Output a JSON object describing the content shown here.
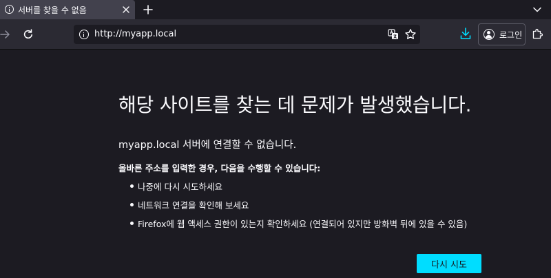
{
  "tab": {
    "title": "서버를 찾을 수 없음"
  },
  "toolbar": {
    "url": "http://myapp.local",
    "login_label": "로그인"
  },
  "error": {
    "title": "해당 사이트를 찾는 데 문제가 발생했습니다.",
    "lead": "myapp.local 서버에 연결할 수 없습니다.",
    "subhead": "올바른 주소를 입력한 경우, 다음을 수행할 수 있습니다:",
    "suggestions": [
      "나중에 다시 시도하세요",
      "네트워크 연결을 확인해 보세요",
      "Firefox에 웹 액세스 권한이 있는지 확인하세요 (연결되어 있지만 방화벽 뒤에 있을 수 있음)"
    ],
    "retry_label": "다시 시도"
  },
  "icons": {
    "tab": [
      "info-icon",
      "close-icon",
      "plus-icon",
      "chevron-down-icon"
    ],
    "toolbar": [
      "back-arrow-icon",
      "reload-icon",
      "info-icon",
      "translate-icon",
      "star-icon",
      "download-icon",
      "account-icon",
      "extensions-icon"
    ]
  },
  "colors": {
    "accent": "#00ddff",
    "background": "#1c1b22",
    "toolbar": "#2b2a33",
    "tab_active": "#42414d"
  }
}
